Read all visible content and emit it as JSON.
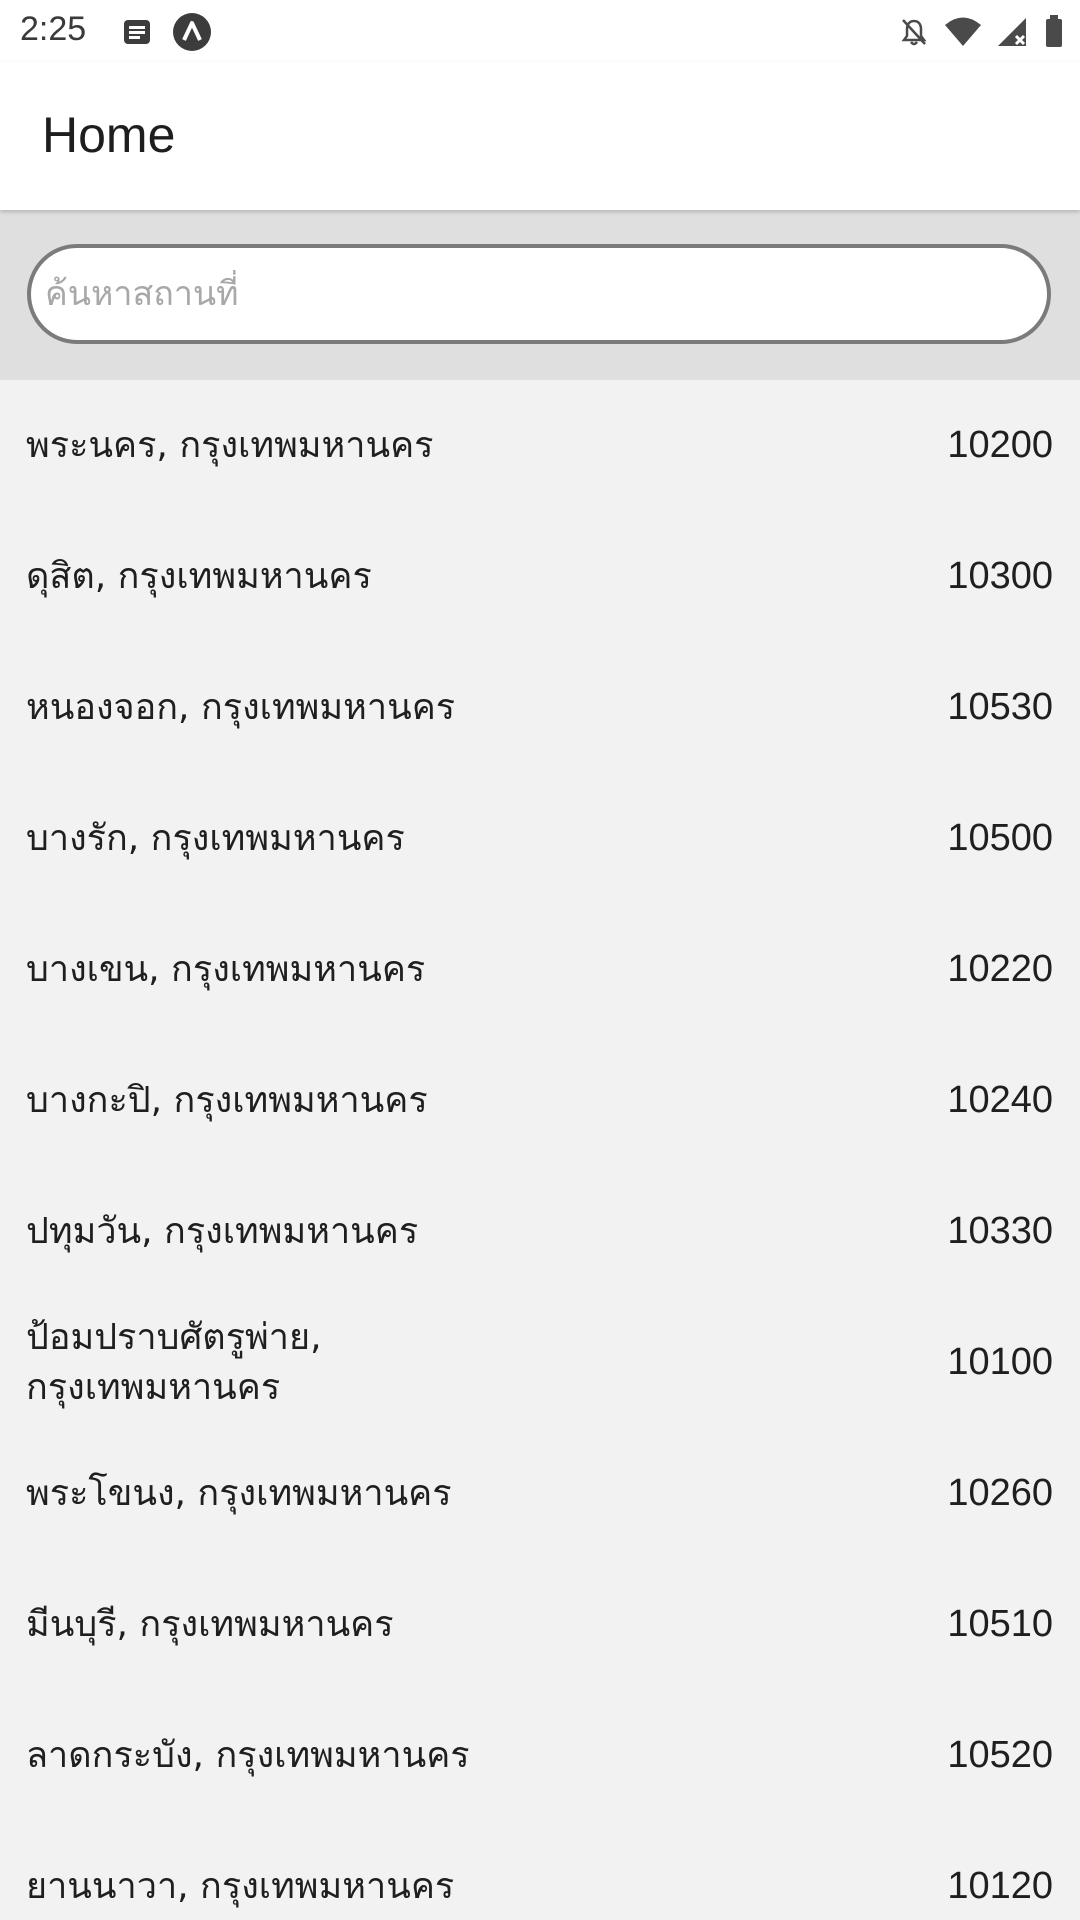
{
  "status_bar": {
    "time": "2:25",
    "left_icons": [
      "notes-icon",
      "app-logo-icon"
    ],
    "right_icons": [
      "bell-off-icon",
      "wifi-icon",
      "signal-icon",
      "battery-icon"
    ]
  },
  "app_bar": {
    "title": "Home"
  },
  "search": {
    "placeholder": "ค้นหาสถานที่",
    "value": ""
  },
  "places": [
    {
      "name": "พระนคร, กรุงเทพมหานคร",
      "postal_code": "10200"
    },
    {
      "name": "ดุสิต, กรุงเทพมหานคร",
      "postal_code": "10300"
    },
    {
      "name": "หนองจอก, กรุงเทพมหานคร",
      "postal_code": "10530"
    },
    {
      "name": "บางรัก, กรุงเทพมหานคร",
      "postal_code": "10500"
    },
    {
      "name": "บางเขน, กรุงเทพมหานคร",
      "postal_code": "10220"
    },
    {
      "name": "บางกะปิ, กรุงเทพมหานคร",
      "postal_code": "10240"
    },
    {
      "name": "ปทุมวัน, กรุงเทพมหานคร",
      "postal_code": "10330"
    },
    {
      "name": "ป้อมปราบศัตรูพ่าย, กรุงเทพมหานคร",
      "postal_code": "10100"
    },
    {
      "name": "พระโขนง, กรุงเทพมหานคร",
      "postal_code": "10260"
    },
    {
      "name": "มีนบุรี, กรุงเทพมหานคร",
      "postal_code": "10510"
    },
    {
      "name": "ลาดกระบัง, กรุงเทพมหานคร",
      "postal_code": "10520"
    },
    {
      "name": "ยานนาวา, กรุงเทพมหานคร",
      "postal_code": "10120"
    }
  ]
}
